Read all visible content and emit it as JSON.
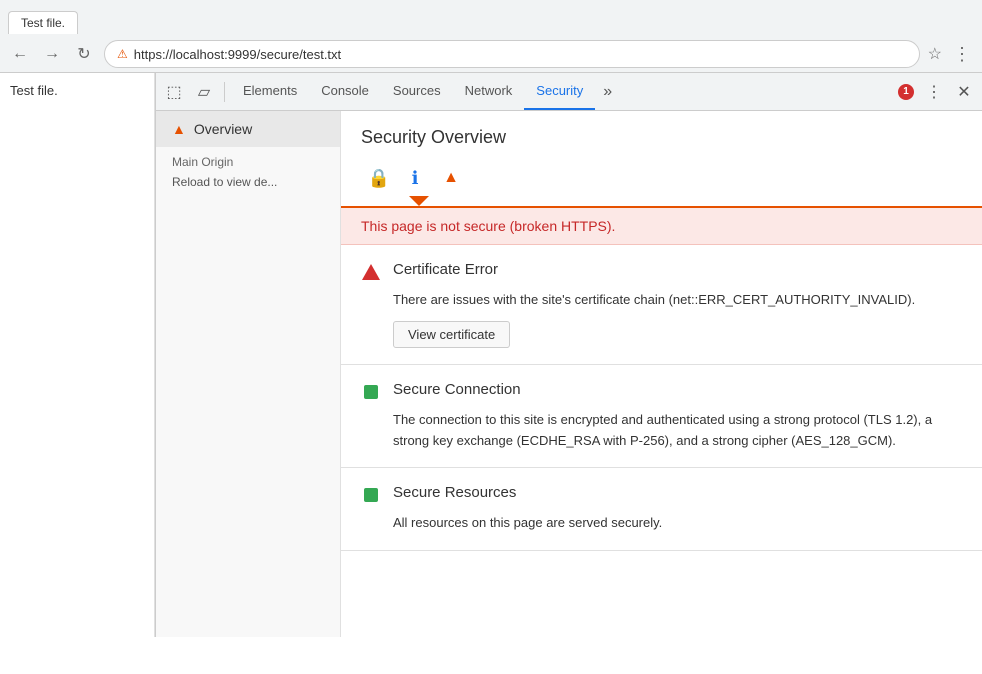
{
  "browser": {
    "tab_title": "Test file.",
    "url_warning_icon": "⚠",
    "url": "https://localhost:9999/secure/test.txt",
    "nav_back": "←",
    "nav_forward": "→",
    "nav_refresh": "↻",
    "star": "☆",
    "more": "⋮"
  },
  "devtools": {
    "toolbar": {
      "inspect_icon": "⬚",
      "device_icon": "▱",
      "tabs": [
        "Elements",
        "Console",
        "Sources",
        "Network",
        "Security"
      ],
      "active_tab": "Security",
      "more_tabs": "»",
      "error_count": "1",
      "dots_icon": "⋮",
      "close_icon": "✕"
    },
    "sidebar": {
      "overview_label": "Overview",
      "warning_icon": "▲",
      "main_origin_label": "Main Origin",
      "reload_text": "Reload to view de..."
    },
    "main": {
      "title": "Security Overview",
      "indicator_lock": "🔒",
      "indicator_info": "ℹ",
      "indicator_warning": "▲",
      "warning_banner": "This page is not secure (broken HTTPS).",
      "cert_error_title": "Certificate Error",
      "cert_error_desc": "There are issues with the site's certificate chain (net::ERR_CERT_AUTHORITY_INVALID).",
      "view_cert_btn": "View certificate",
      "secure_conn_title": "Secure Connection",
      "secure_conn_desc": "The connection to this site is encrypted and authenticated using a strong protocol (TLS 1.2), a strong key exchange (ECDHE_RSA with P-256), and a strong cipher (AES_128_GCM).",
      "secure_res_title": "Secure Resources",
      "secure_res_desc": "All resources on this page are served securely."
    }
  }
}
